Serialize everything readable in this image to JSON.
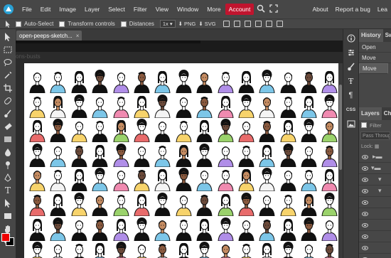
{
  "menu": {
    "items": [
      "File",
      "Edit",
      "Image",
      "Layer",
      "Select",
      "Filter",
      "View",
      "Window",
      "More"
    ],
    "account": "Account",
    "right": [
      "About",
      "Report a bug",
      "Lea"
    ]
  },
  "options": {
    "auto_select": "Auto-Select",
    "transform_controls": "Transform controls",
    "distances": "Distances",
    "zoom": "1x",
    "png": "PNG",
    "svg": "SVG"
  },
  "document": {
    "tab_title": "open-peeps-sketch...",
    "close": "×",
    "ghost_label": "ons-busts"
  },
  "history": {
    "tabs": [
      "History",
      "Sw"
    ],
    "rows": [
      "Open",
      "Move",
      "Move"
    ]
  },
  "layers": {
    "tabs": [
      "Layers",
      "Cha"
    ],
    "filter": "Filter",
    "blend": "Pass Through",
    "lock": "Lock:"
  },
  "colors": {
    "accent": "#c0142e",
    "foreground": "#ee0000",
    "background": "#000000"
  }
}
